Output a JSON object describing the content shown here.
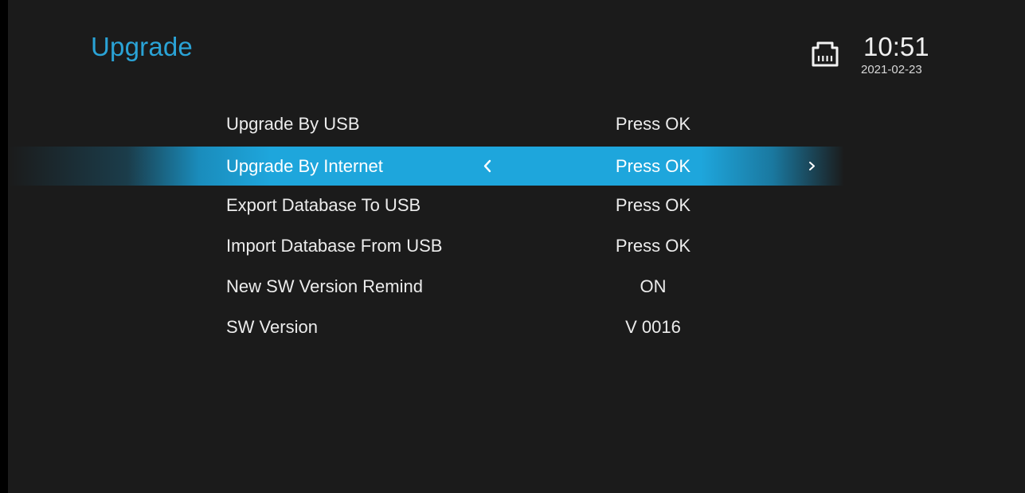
{
  "header": {
    "title": "Upgrade"
  },
  "status": {
    "network_icon": "ethernet-icon",
    "time": "10:51",
    "date": "2021-02-23"
  },
  "menu": {
    "selected_index": 1,
    "items": [
      {
        "label": "Upgrade By USB",
        "value": "Press OK"
      },
      {
        "label": "Upgrade By Internet",
        "value": "Press OK"
      },
      {
        "label": "Export Database To USB",
        "value": "Press OK"
      },
      {
        "label": "Import Database From USB",
        "value": "Press OK"
      },
      {
        "label": "New SW Version Remind",
        "value": "ON"
      },
      {
        "label": "SW Version",
        "value": "V 0016"
      }
    ]
  },
  "colors": {
    "background": "#1b1b1b",
    "accent": "#2aa3d6",
    "highlight": "#1ea6dc",
    "text": "#ececec"
  },
  "icons": {
    "left_arrow": "chevron-left-icon",
    "right_arrow": "chevron-right-icon"
  }
}
